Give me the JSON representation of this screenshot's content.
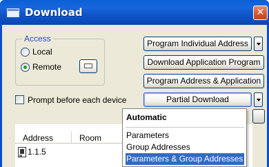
{
  "window": {
    "title": "Download",
    "close_glyph": "✕"
  },
  "access": {
    "legend": "Access",
    "options": [
      {
        "label": "Local",
        "checked": false
      },
      {
        "label": "Remote",
        "checked": true
      }
    ]
  },
  "prompt_checkbox": {
    "label": "Prompt before each device",
    "checked": false
  },
  "buttons": {
    "program_individual_address": "Program Individual Address",
    "download_application_program": "Download Application Program",
    "program_address_application": "Program Address & Application",
    "partial_download": "Partial Download"
  },
  "list": {
    "columns": [
      "Address",
      "Room"
    ],
    "rows": [
      {
        "address": "1.1.5"
      }
    ]
  },
  "dropdown_menu": {
    "items": [
      {
        "label": "Automatic",
        "bold": true
      },
      {
        "label": "Parameters"
      },
      {
        "label": "Group Addresses"
      },
      {
        "label": "Parameters & Group Addresses",
        "selected": true
      }
    ]
  },
  "colors": {
    "titlebar": "#0a5fd6",
    "window_bg": "#ece9d8",
    "selection": "#316ac5",
    "legend_text": "#2a4fc4",
    "radio_dot": "#21a121"
  },
  "icons": {
    "title": "window-icon",
    "close": "close-icon",
    "device": "device-icon",
    "dropdown": "chevron-down-icon"
  }
}
